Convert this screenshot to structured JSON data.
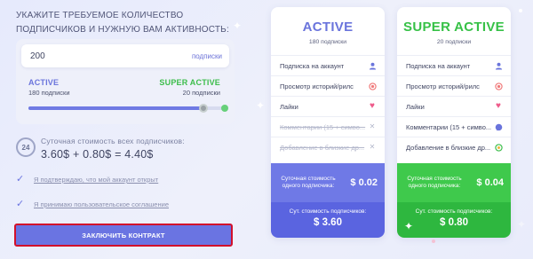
{
  "heading": "УКАЖИТЕ ТРЕБУЕМОЕ КОЛИЧЕСТВО ПОДПИСЧИКОВ И НУЖНУЮ ВАМ АКТИВНОСТЬ:",
  "amount": {
    "value": "200",
    "unit": "подписки"
  },
  "slider": {
    "level": 0.88,
    "left_plan": {
      "name": "ACTIVE",
      "count": "180 подписки"
    },
    "right_plan": {
      "name": "SUPER ACTIVE",
      "count": "20 подписки"
    }
  },
  "cost": {
    "icon_text": "24",
    "label": "Суточная стоимость всех подписчиков:",
    "formula": "3.60$ + 0.80$ = 4.40$"
  },
  "agreements": [
    {
      "text": "Я подтверждаю, что мой аккаунт открыт",
      "checked": true
    },
    {
      "text": "Я принимаю пользовательское соглашение",
      "checked": true
    }
  ],
  "cta_label": "ЗАКЛЮЧИТЬ КОНТРАКТ",
  "cards": {
    "active": {
      "title": "ACTIVE",
      "subtitle": "180 подписки",
      "features": [
        {
          "text": "Подписка на аккаунт",
          "icon": "user-icon",
          "enabled": true
        },
        {
          "text": "Просмотр историй/рилс",
          "icon": "record-icon",
          "enabled": true
        },
        {
          "text": "Лайки",
          "icon": "heart-icon",
          "enabled": true
        },
        {
          "text": "Комментарии (15 + симво...",
          "icon": "close-icon",
          "enabled": false
        },
        {
          "text": "Добавление в близкие др...",
          "icon": "close-icon",
          "enabled": false
        }
      ],
      "daily_label": "Суточная стоимость одного подписчика:",
      "daily_price": "$ 0.02",
      "total_label": "Сут. стоимость подписчиков:",
      "total_price": "$ 3.60"
    },
    "super": {
      "title": "SUPER ACTIVE",
      "subtitle": "20 подписки",
      "features": [
        {
          "text": "Подписка на аккаунт",
          "icon": "user-icon",
          "enabled": true
        },
        {
          "text": "Просмотр историй/рилс",
          "icon": "record-icon",
          "enabled": true
        },
        {
          "text": "Лайки",
          "icon": "heart-icon",
          "enabled": true
        },
        {
          "text": "Комментарии (15 + симво...",
          "icon": "comment-icon",
          "enabled": true
        },
        {
          "text": "Добавление в близкие др...",
          "icon": "star-circle-icon",
          "enabled": true
        }
      ],
      "daily_label": "Суточная стоимость одного подписчика:",
      "daily_price": "$ 0.04",
      "total_label": "Сут. стоимость подписчиков:",
      "total_price": "$ 0.80"
    }
  },
  "colors": {
    "accent_blue": "#6a74e2",
    "accent_green": "#3fc94c",
    "cta_border": "#d2102b"
  }
}
